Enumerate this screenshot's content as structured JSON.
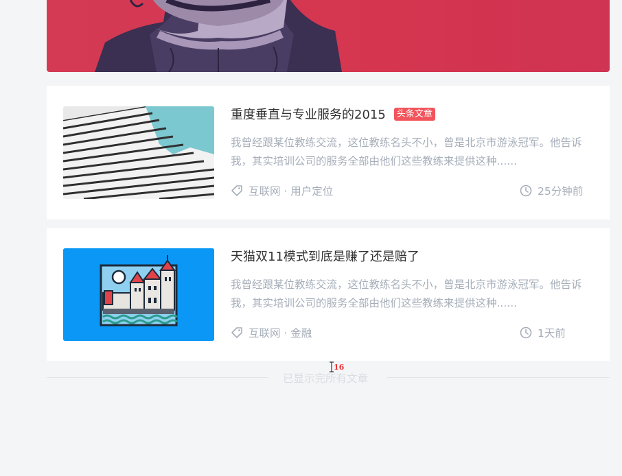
{
  "articles": [
    {
      "title": "重度垂直与专业服务的2015",
      "badge": "头条文章",
      "excerpt": "我曾经跟某位教练交流，这位教练名头不小，曾是北京市游泳冠军。他告诉我，其实培训公司的服务全部由他们这些教练来提供这种......",
      "tags": "互联网 · 用户定位",
      "time": "25分钟前"
    },
    {
      "title": "天猫双11模式到底是赚了还是赔了",
      "excerpt": "我曾经跟某位教练交流，这位教练名头不小，曾是北京市游泳冠军。他告诉我，其实培训公司的服务全部由他们这些教练来提供这种......",
      "tags": "互联网 · 金融",
      "time": "1天前"
    }
  ],
  "footer": {
    "end_text": "已显示完所有文章"
  },
  "overlay": {
    "cursor_badge": "16"
  }
}
